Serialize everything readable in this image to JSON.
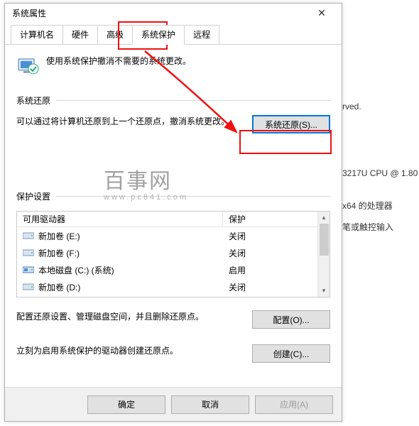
{
  "bg": {
    "rights": "rved.",
    "cpu": "3217U CPU @ 1.80",
    "arch": "x64 的处理器",
    "touch": "笔或触控输入"
  },
  "dialog": {
    "title": "系统属性",
    "tabs": {
      "computer_name": "计算机名",
      "hardware": "硬件",
      "advanced": "高级",
      "system_protection": "系统保护",
      "remote": "远程"
    },
    "intro": "使用系统保护撤消不需要的系统更改。",
    "restore": {
      "section": "系统还原",
      "text": "可以通过将计算机还原到上一个还原点，撤消系统更改。",
      "button": "系统还原(S)..."
    },
    "protection": {
      "section": "保护设置",
      "header_drive": "可用驱动器",
      "header_status": "保护",
      "rows": [
        {
          "name": "新加卷 (E:)",
          "status": "关闭",
          "icon": "hdd"
        },
        {
          "name": "新加卷 (F:)",
          "status": "关闭",
          "icon": "hdd"
        },
        {
          "name": "本地磁盘 (C:) (系统)",
          "status": "启用",
          "icon": "sys"
        },
        {
          "name": "新加卷 (D:)",
          "status": "关闭",
          "icon": "hdd"
        }
      ],
      "configure_text": "配置还原设置、管理磁盘空间，并且删除还原点。",
      "configure_button": "配置(O)...",
      "create_text": "立刻为启用系统保护的驱动器创建还原点。",
      "create_button": "创建(C)..."
    },
    "buttons": {
      "ok": "确定",
      "cancel": "取消",
      "apply": "应用(A)"
    }
  },
  "watermark": {
    "big": "百事网",
    "small": "www.pc841.com"
  }
}
